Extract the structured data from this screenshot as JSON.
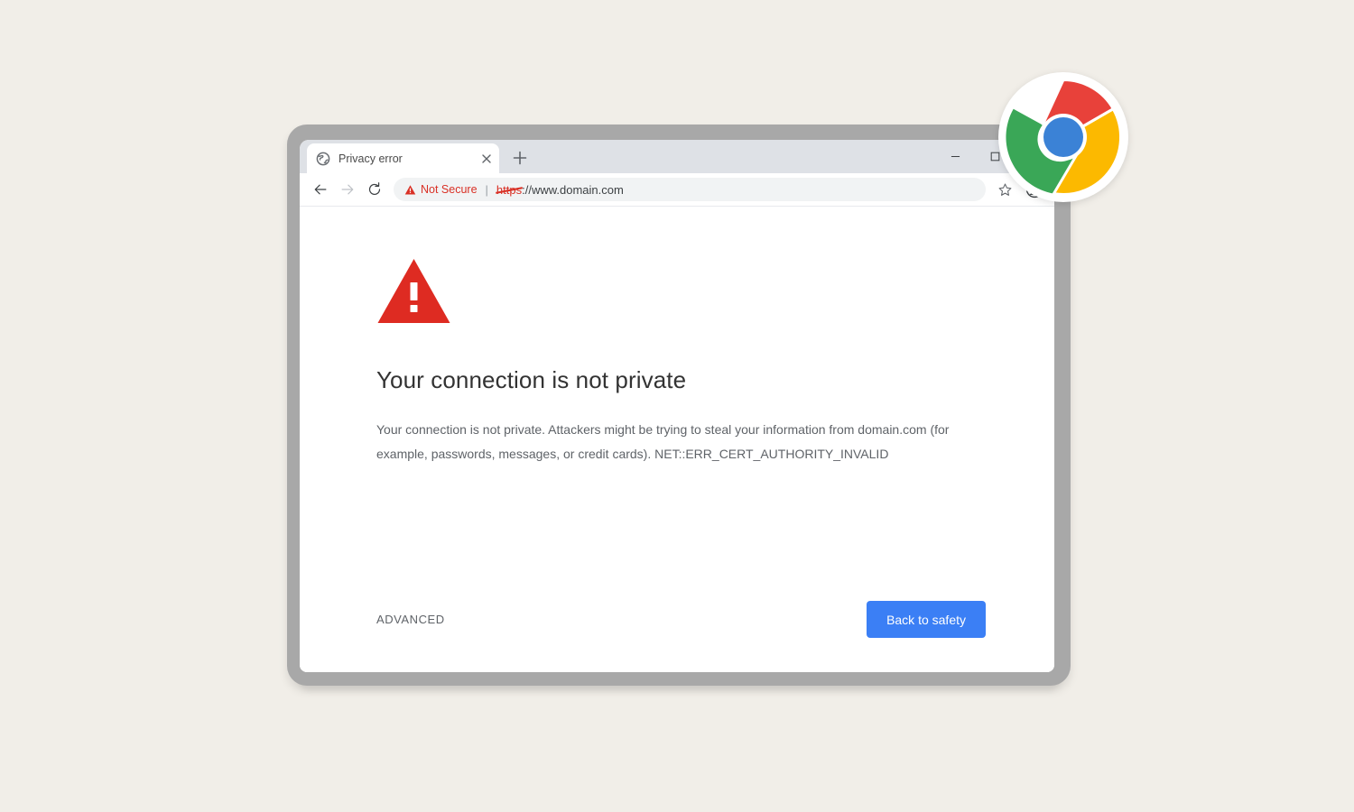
{
  "background_color": "#f1eee8",
  "browser": {
    "frame_color": "#a8a8a8",
    "tab": {
      "title": "Privacy error",
      "favicon_name": "globe-icon",
      "close_label": "×"
    },
    "new_tab_label": "+",
    "window_controls": {
      "minimize_label": "—",
      "maximize_label": "□"
    },
    "toolbar": {
      "back_label": "←",
      "forward_label": "→",
      "reload_label": "⟳",
      "security_badge": "Not Secure",
      "security_color": "#d93025",
      "divider": "|",
      "url_scheme": "https",
      "url_rest": "://www.domain.com",
      "bookmark_icon": "star-icon",
      "profile_icon": "account-avatar-icon"
    }
  },
  "page": {
    "warning_icon": "red-warning-triangle-icon",
    "warning_color": "#de2b22",
    "heading": "Your connection is not private",
    "body": "Your connection is not private. Attackers might be trying to steal your information from domain.com (for example, passwords, messages, or credit cards). NET::ERR_CERT_AUTHORITY_INVALID",
    "advanced_label": "ADVANCED",
    "back_to_safety_label": "Back to safety",
    "button_color": "#3b7ff5"
  },
  "logo": {
    "name": "chrome-logo",
    "colors": {
      "red": "#e8413a",
      "yellow": "#fcb900",
      "green": "#3aa757",
      "blue": "#3b82d6",
      "ring": "#ffffff"
    }
  }
}
